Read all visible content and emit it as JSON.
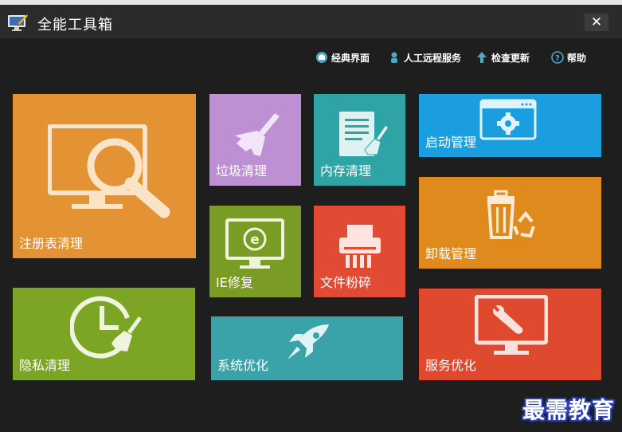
{
  "app": {
    "title": "全能工具箱",
    "close_glyph": "✕"
  },
  "toolbar": [
    {
      "label": "经典界面",
      "icon": "classic-view-icon"
    },
    {
      "label": "人工远程服务",
      "icon": "support-agent-icon"
    },
    {
      "label": "检查更新",
      "icon": "update-arrow-icon"
    },
    {
      "label": "帮助",
      "icon": "help-icon"
    }
  ],
  "tiles": {
    "registry": {
      "label": "注册表清理",
      "color": "#e39234",
      "icon": "monitor-magnifier-icon"
    },
    "junk": {
      "label": "垃圾清理",
      "color": "#be8fd3",
      "icon": "broom-icon"
    },
    "memory": {
      "label": "内存清理",
      "color": "#2fa4a6",
      "icon": "document-broom-icon"
    },
    "startup": {
      "label": "启动管理",
      "color": "#1a9ee0",
      "icon": "window-gear-icon"
    },
    "ie": {
      "label": "IE修复",
      "color": "#7a9b24",
      "icon": "ie-monitor-icon"
    },
    "shredder": {
      "label": "文件粉碎",
      "color": "#e14a33",
      "icon": "shredder-icon"
    },
    "uninstall": {
      "label": "卸载管理",
      "color": "#e08a1e",
      "icon": "recycle-bin-icon"
    },
    "privacy": {
      "label": "隐私清理",
      "color": "#7ca526",
      "icon": "clock-broom-icon"
    },
    "optimize": {
      "label": "系统优化",
      "color": "#3aa3aa",
      "icon": "rocket-icon"
    },
    "service": {
      "label": "服务优化",
      "color": "#df4a2e",
      "icon": "monitor-wrench-icon"
    }
  },
  "watermark": "最需教育"
}
